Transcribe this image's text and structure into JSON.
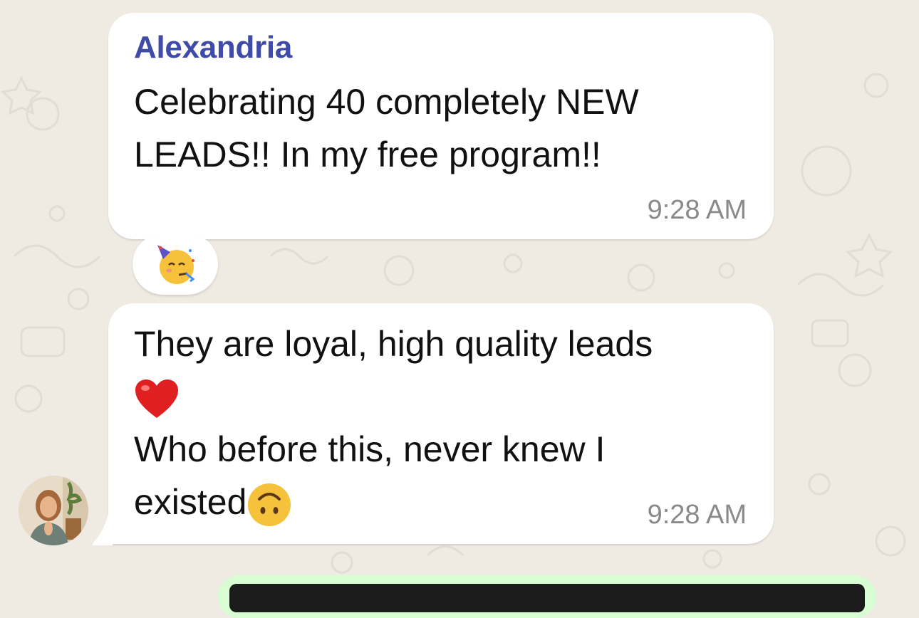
{
  "chat": {
    "messages": [
      {
        "sender": "Alexandria",
        "text_lines": [
          "Celebrating 40 completely NEW",
          "LEADS!! In my free program!!"
        ],
        "time": "9:28 AM",
        "reaction_icon": "partying-face-emoji"
      },
      {
        "line1": "They are loyal, high quality leads",
        "line2_icon": "red-heart-emoji",
        "line3": "Who before this, never knew I",
        "line4": "existed",
        "line4_icon": "upside-down-face-emoji",
        "time": "9:28 AM"
      }
    ]
  },
  "colors": {
    "background": "#efeae2",
    "bubble_incoming": "#ffffff",
    "bubble_outgoing": "#d9fdd3",
    "sender_name": "#3f4ba8",
    "timestamp": "#8a8a8a"
  }
}
